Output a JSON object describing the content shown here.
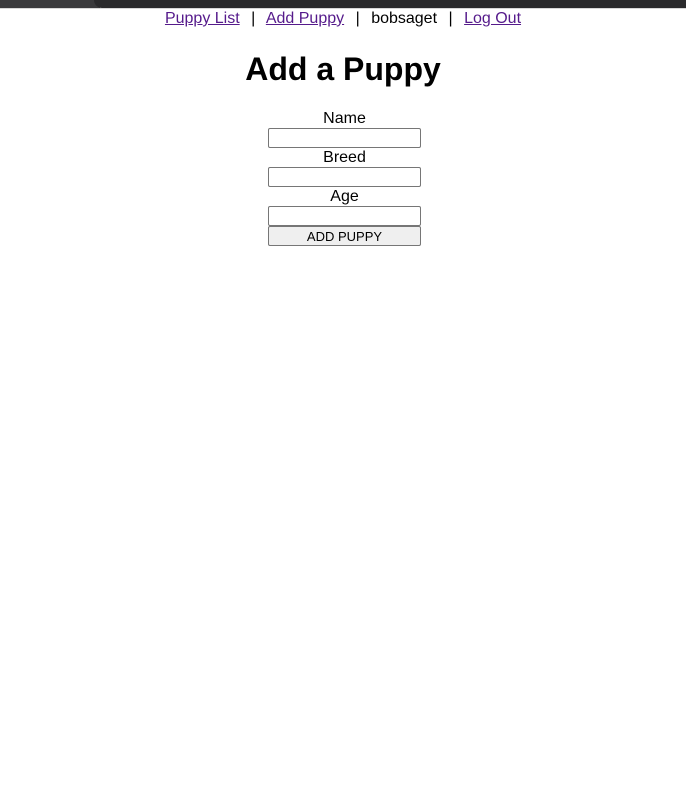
{
  "nav": {
    "puppy_list": "Puppy List",
    "add_puppy": "Add Puppy",
    "username": "bobsaget",
    "log_out": "Log Out",
    "separator": "|"
  },
  "page": {
    "title": "Add a Puppy"
  },
  "form": {
    "name_label": "Name",
    "name_value": "",
    "breed_label": "Breed",
    "breed_value": "",
    "age_label": "Age",
    "age_value": "",
    "submit_label": "ADD PUPPY"
  },
  "colors": {
    "link": "#551a8b",
    "window_chrome": "#2a2a2c",
    "button_bg": "#efefef"
  }
}
